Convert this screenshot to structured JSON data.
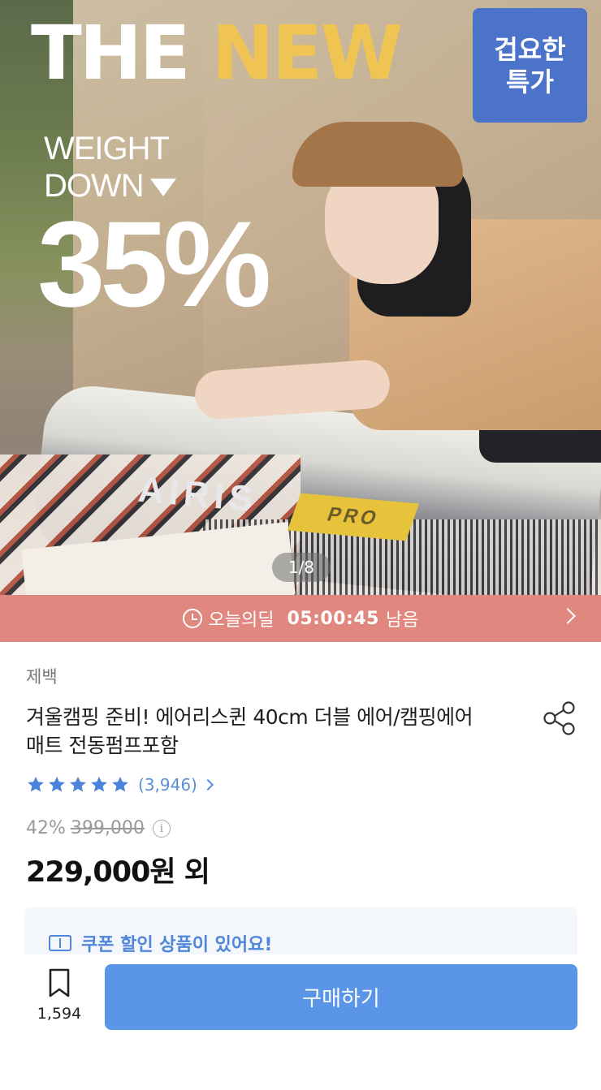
{
  "hero": {
    "title_white": "THE ",
    "title_yellow": "NEW",
    "weight_line1": "WEIGHT",
    "weight_line2": "DOWN",
    "percent": "35%",
    "badge_line1": "겁요한",
    "badge_line2": "특가",
    "mat_brand": "AIRIS",
    "mat_tag": "PRO",
    "pager": "1/8",
    "colors": {
      "title_yellow": "#f0c452",
      "badge_bg": "#4a73c9"
    }
  },
  "deal": {
    "icon": "clock-icon",
    "label": "오늘의딜",
    "timer": "05:00:45",
    "suffix": "남음",
    "bg_color": "#e0877f"
  },
  "product": {
    "brand": "제백",
    "title": "겨울캠핑 준비! 에어리스퀸 40cm 더블 에어/캠핑에어매트 전동펌프포함",
    "rating_stars": 5,
    "review_count": "(3,946)",
    "discount_rate": "42%",
    "original_price": "399,000",
    "price": "229,000원 외"
  },
  "coupon": {
    "text": "쿠폰 할인 상품이 있어요!"
  },
  "bottom_bar": {
    "bookmark_count": "1,594",
    "buy_label": "구매하기",
    "buy_color": "#5b95e8"
  }
}
